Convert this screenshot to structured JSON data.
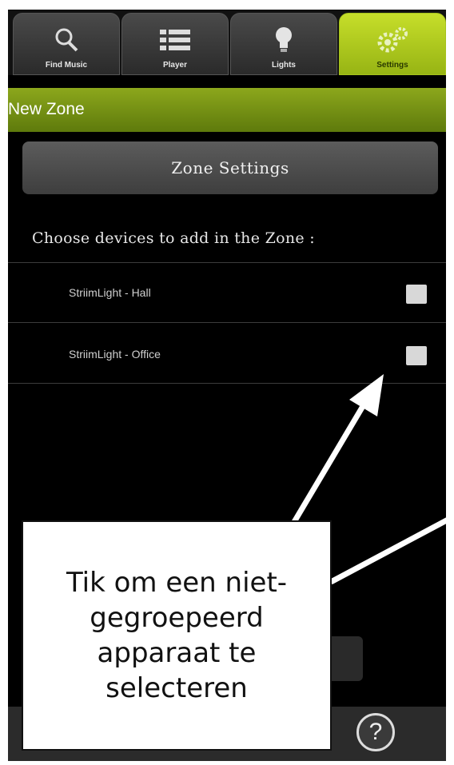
{
  "tabs": [
    {
      "label": "Find Music",
      "icon": "search-icon",
      "active": false
    },
    {
      "label": "Player",
      "icon": "list-icon",
      "active": false
    },
    {
      "label": "Lights",
      "icon": "lightbulb-icon",
      "active": false
    },
    {
      "label": "Settings",
      "icon": "gears-icon",
      "active": true
    }
  ],
  "header": {
    "title": "New Zone"
  },
  "zone_settings_label": "Zone Settings",
  "choose_label": "Choose devices to add in the Zone :",
  "devices": [
    {
      "label": "StriimLight - Hall",
      "checked": false
    },
    {
      "label": "StriimLight - Office",
      "checked": false
    }
  ],
  "help_label": "?",
  "callout": {
    "text": "Tik om een niet-\ngegroepeerd\napparaat te\nselecteren"
  },
  "colors": {
    "accent": "#97b414",
    "header": "#7a9616"
  }
}
